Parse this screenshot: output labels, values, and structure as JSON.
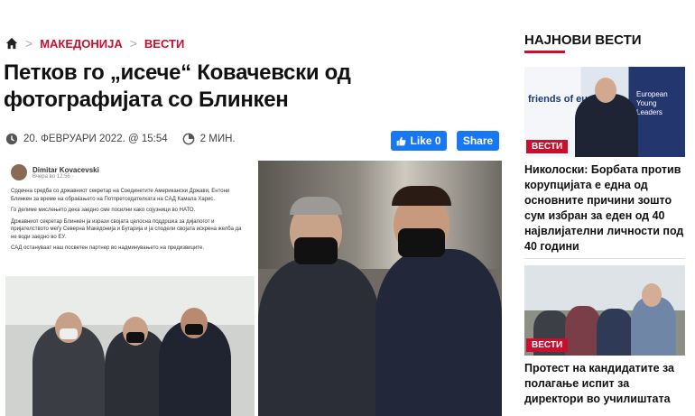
{
  "breadcrumb": {
    "items": [
      "МАКЕДОНИЈА",
      "ВЕСТИ"
    ]
  },
  "article": {
    "title": "Петков го „исече“ Ковачевски од фотографијата со Блинкен",
    "date": "20. ФЕВРУАРИ 2022. @ 15:54",
    "read_time": "2 МИН.",
    "like_label": "Like 0",
    "share_label": "Share"
  },
  "fb_post": {
    "author": "Dimitar Kovacevski",
    "time": "Вчера во 12:56 · ",
    "paragraphs": [
      "Срдечна средба со државниот секретар на Соединетите Американски Држави, Ентони Блинкен за време на обраќањето на Потпретседателката на САД Камала Харис.",
      "Го делиме мислењето дека заедно сме посилни како сојузници во НАТО.",
      "Државниот секретар Блинкен ја изрази својата целосна поддршка за дијалогот и пријателството меѓу Северна Македонија и Бугарија и ја сподели својата искрена желба да не води заедно во ЕУ.",
      "САД остануваат наш посветен партнер во надминувањето на предизвиците."
    ]
  },
  "sidebar": {
    "title": "НАЈНОВИ ВЕСТИ",
    "cards": [
      {
        "badge": "ВЕСТИ",
        "img_text_left": "friends of eu",
        "img_text_right": "European Young Leaders",
        "title": "Николоски: Борбата против корупцијата е една од основните причини зошто сум избран за еден од 40 највлијателни личности под 40 години"
      },
      {
        "badge": "ВЕСТИ",
        "title": "Протест на кандидатите за полагање испит за директори во училиштата"
      }
    ]
  },
  "colors": {
    "accent": "#c8102e",
    "facebook": "#1877f2"
  },
  "icons": {
    "home": "home-icon",
    "clock": "clock-icon",
    "timer": "timer-icon",
    "thumb": "thumb-up-icon",
    "sep": "chevron-right-icon"
  }
}
